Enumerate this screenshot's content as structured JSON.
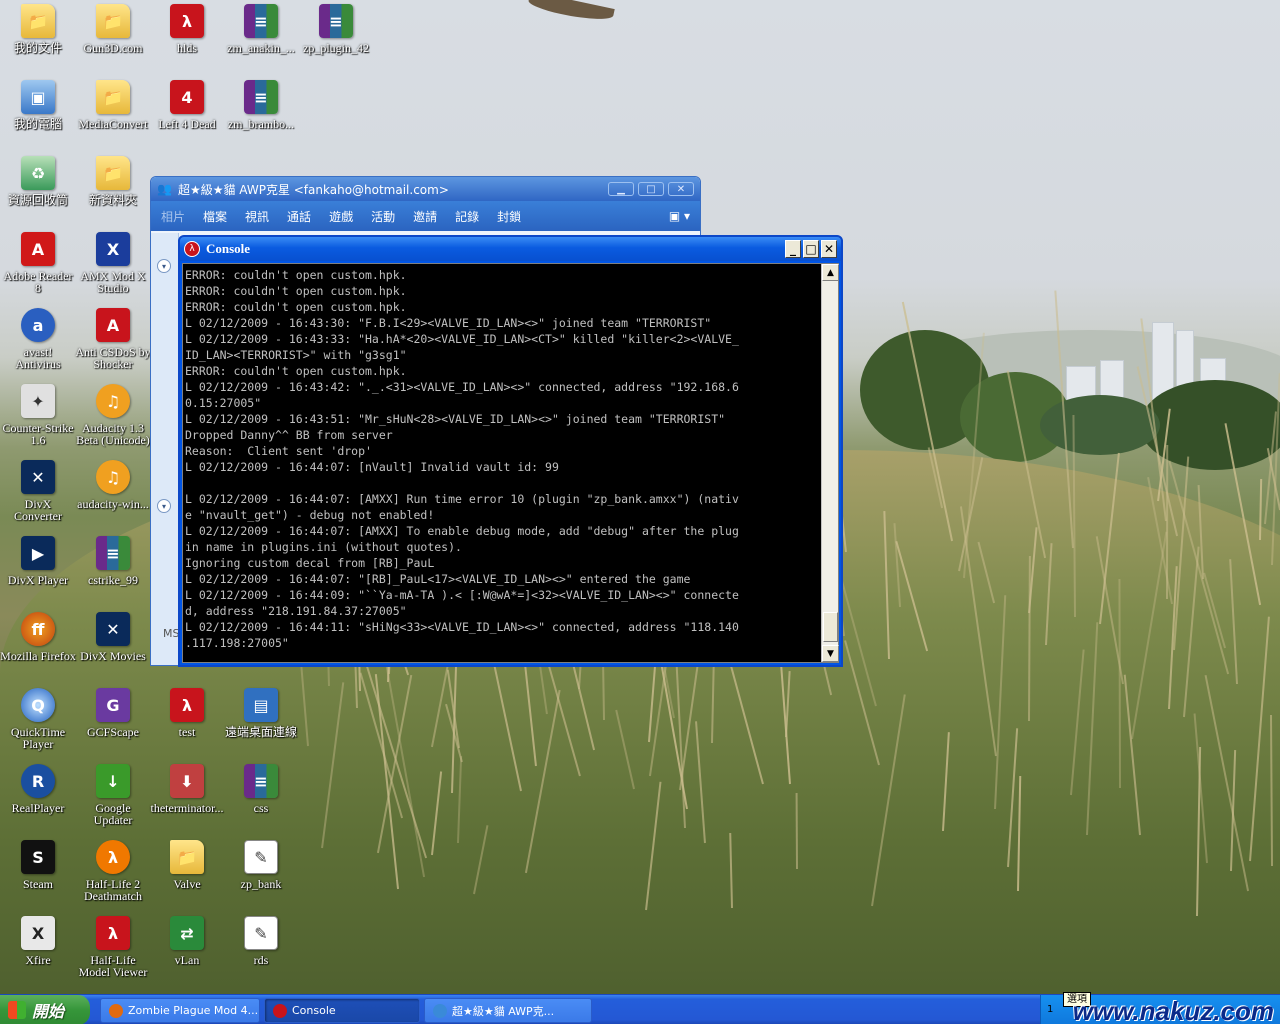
{
  "desktop_icons": [
    {
      "label": "我的文件",
      "glyph": "📁",
      "cls": "g-folder"
    },
    {
      "label": "Gun3D.com",
      "glyph": "📁",
      "cls": "g-folder"
    },
    {
      "label": "hlds",
      "glyph": "λ",
      "cls": "g-red"
    },
    {
      "label": "zm_anakin_...",
      "glyph": "≡",
      "cls": "g-rar"
    },
    {
      "label": "zp_plugin_42",
      "glyph": "≡",
      "cls": "g-rar"
    },
    {
      "label": "我的電腦",
      "glyph": "▣",
      "cls": "g-pc"
    },
    {
      "label": "MediaConvert",
      "glyph": "📁",
      "cls": "g-folder"
    },
    {
      "label": "Left 4 Dead",
      "glyph": "4",
      "cls": "g-red"
    },
    {
      "label": "zm_brambo...",
      "glyph": "≡",
      "cls": "g-rar"
    },
    {
      "label": "資源回收筒",
      "glyph": "♻",
      "cls": "g-bin"
    },
    {
      "label": "新資料夾",
      "glyph": "📁",
      "cls": "g-folder"
    },
    {
      "label": "Adobe Reader 8",
      "glyph": "A",
      "cls": "g-pdf"
    },
    {
      "label": "AMX Mod X Studio",
      "glyph": "X",
      "cls": "g-amx"
    },
    {
      "label": "avast! Antivirus",
      "glyph": "a",
      "cls": "g-avast"
    },
    {
      "label": "Anti CSDoS by Shocker",
      "glyph": "A",
      "cls": "g-red"
    },
    {
      "label": "Counter-Strike 1.6",
      "glyph": "✦",
      "cls": "g-cs"
    },
    {
      "label": "Audacity 1.3 Beta (Unicode)",
      "glyph": "♫",
      "cls": "g-aud"
    },
    {
      "label": "DivX Converter",
      "glyph": "✕",
      "cls": "g-divx"
    },
    {
      "label": "audacity-win...",
      "glyph": "♫",
      "cls": "g-aud"
    },
    {
      "label": "DivX Player",
      "glyph": "▶",
      "cls": "g-divx"
    },
    {
      "label": "cstrike_99",
      "glyph": "≡",
      "cls": "g-rar"
    },
    {
      "label": "Mozilla Firefox",
      "glyph": "ff",
      "cls": "g-ff"
    },
    {
      "label": "DivX Movies",
      "glyph": "✕",
      "cls": "g-divx"
    },
    {
      "label": "QuickTime Player",
      "glyph": "Q",
      "cls": "g-qt"
    },
    {
      "label": "GCFScape",
      "glyph": "G",
      "cls": "g-gcf"
    },
    {
      "label": "test",
      "glyph": "λ",
      "cls": "g-red"
    },
    {
      "label": "遠端桌面連線",
      "glyph": "▤",
      "cls": "g-rd"
    },
    {
      "label": "RealPlayer",
      "glyph": "R",
      "cls": "g-real"
    },
    {
      "label": "Google Updater",
      "glyph": "↓",
      "cls": "g-google"
    },
    {
      "label": "theterminator...",
      "glyph": "⬇",
      "cls": "g-term"
    },
    {
      "label": "css",
      "glyph": "≡",
      "cls": "g-rar"
    },
    {
      "label": "Steam",
      "glyph": "S",
      "cls": "g-steam"
    },
    {
      "label": "Half-Life 2 Deathmatch",
      "glyph": "λ",
      "cls": "g-hl"
    },
    {
      "label": "Valve",
      "glyph": "📁",
      "cls": "g-folder"
    },
    {
      "label": "zp_bank",
      "glyph": "✎",
      "cls": "g-doc"
    },
    {
      "label": "Xfire",
      "glyph": "X",
      "cls": "g-xfire"
    },
    {
      "label": "Half-Life Model Viewer",
      "glyph": "λ",
      "cls": "g-red"
    },
    {
      "label": "vLan",
      "glyph": "⇄",
      "cls": "g-net"
    },
    {
      "label": "rds",
      "glyph": "✎",
      "cls": "g-doc"
    }
  ],
  "messenger": {
    "title": "超★級★貓    AWP克星  <fankaho@hotmail.com>",
    "ctrl_min": "▁",
    "ctrl_max": "□",
    "ctrl_close": "✕",
    "menu": [
      "相片",
      "檔案",
      "視訊",
      "通話",
      "遊戲",
      "活動",
      "邀請",
      "記錄",
      "封鎖"
    ],
    "menu_tool": "▣ ▾",
    "arrow_up": "▾",
    "arrow_down": "▾",
    "bottom_text": "MS"
  },
  "console": {
    "title": "Console",
    "btn_min": "_",
    "btn_max": "□",
    "btn_close": "✕",
    "scroll_up": "▲",
    "scroll_down": "▼",
    "lines": [
      "ERROR: couldn't open custom.hpk.",
      "ERROR: couldn't open custom.hpk.",
      "ERROR: couldn't open custom.hpk.",
      "L 02/12/2009 - 16:43:30: \"F.B.I<29><VALVE_ID_LAN><>\" joined team \"TERRORIST\"",
      "L 02/12/2009 - 16:43:33: \"Ha.hA*<20><VALVE_ID_LAN><CT>\" killed \"killer<2><VALVE_",
      "ID_LAN><TERRORIST>\" with \"g3sg1\"",
      "ERROR: couldn't open custom.hpk.",
      "L 02/12/2009 - 16:43:42: \"._.<31><VALVE_ID_LAN><>\" connected, address \"192.168.6",
      "0.15:27005\"",
      "L 02/12/2009 - 16:43:51: \"Mr_sHuN<28><VALVE_ID_LAN><>\" joined team \"TERRORIST\"",
      "Dropped Danny^^ BB from server",
      "Reason:  Client sent 'drop'",
      "L 02/12/2009 - 16:44:07: [nVault] Invalid vault id: 99",
      "",
      "L 02/12/2009 - 16:44:07: [AMXX] Run time error 10 (plugin \"zp_bank.amxx\") (nativ",
      "e \"nvault_get\") - debug not enabled!",
      "L 02/12/2009 - 16:44:07: [AMXX] To enable debug mode, add \"debug\" after the plug",
      "in name in plugins.ini (without quotes).",
      "Ignoring custom decal from [RB]_PauL",
      "L 02/12/2009 - 16:44:07: \"[RB]_PauL<17><VALVE_ID_LAN><>\" entered the game",
      "L 02/12/2009 - 16:44:09: \"``Ya-mA-TA ).< [:W@wA*=]<32><VALVE_ID_LAN><>\" connecte",
      "d, address \"218.191.84.37:27005\"",
      "L 02/12/2009 - 16:44:11: \"sHiNg<33><VALVE_ID_LAN><>\" connected, address \"118.140",
      ".117.198:27005\""
    ]
  },
  "taskbar": {
    "start_label": "開始",
    "tasks": [
      {
        "label": "Zombie Plague Mod 4....",
        "color": "#e06a10",
        "active": false
      },
      {
        "label": "Console",
        "color": "#c8141c",
        "active": true
      },
      {
        "label": "超★級★貓    AWP克...",
        "color": "#3a8ad8",
        "active": false
      }
    ],
    "tray_tooltip": "選項",
    "tray_number": "1",
    "watermark": "www.nakuz.com"
  }
}
